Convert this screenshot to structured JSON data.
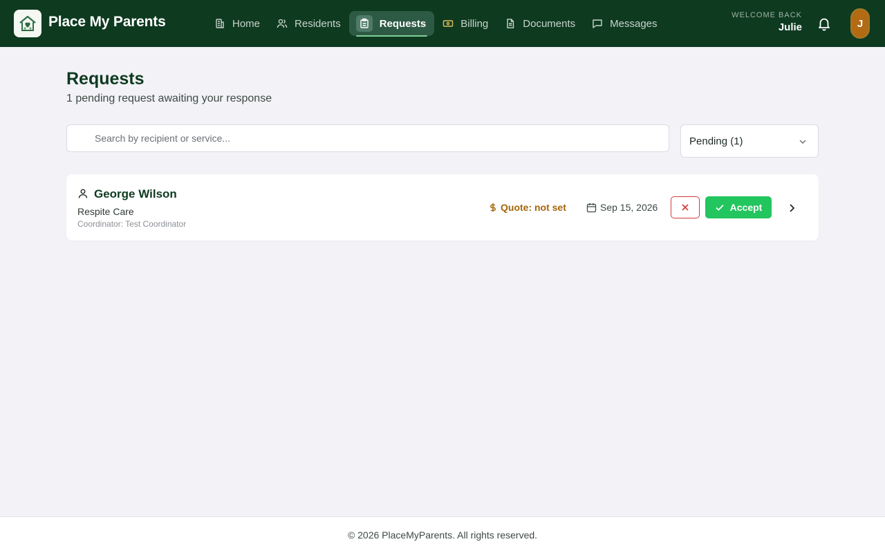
{
  "header": {
    "brand": "Place My Parents",
    "nav": [
      {
        "label": "Home",
        "icon": "building-icon"
      },
      {
        "label": "Residents",
        "icon": "users-icon"
      },
      {
        "label": "Requests",
        "icon": "clipboard-icon",
        "active": true
      },
      {
        "label": "Billing",
        "icon": "banknote-icon"
      },
      {
        "label": "Documents",
        "icon": "document-icon"
      },
      {
        "label": "Messages",
        "icon": "message-icon"
      }
    ],
    "welcome_label": "Welcome back",
    "user_name": "Julie",
    "avatar_initial": "J"
  },
  "page": {
    "title": "Requests",
    "subtitle": "1 pending request awaiting your response"
  },
  "filters": {
    "search_placeholder": "Search by recipient or service...",
    "status_selected": "Pending (1)"
  },
  "requests": [
    {
      "recipient": "George Wilson",
      "service": "Respite Care",
      "coordinator": "Coordinator: Test Coordinator",
      "quote": "Quote: not set",
      "date": "Sep 15, 2026",
      "accept_label": "Accept"
    }
  ],
  "footer": {
    "copyright": "© 2026 PlaceMyParents. All rights reserved."
  },
  "colors": {
    "header_bg": "#0e3a20",
    "accent_green": "#22c55e",
    "quote_amber": "#a5650b",
    "reject_red": "#d23b3b",
    "avatar_bg": "#b26a13"
  }
}
